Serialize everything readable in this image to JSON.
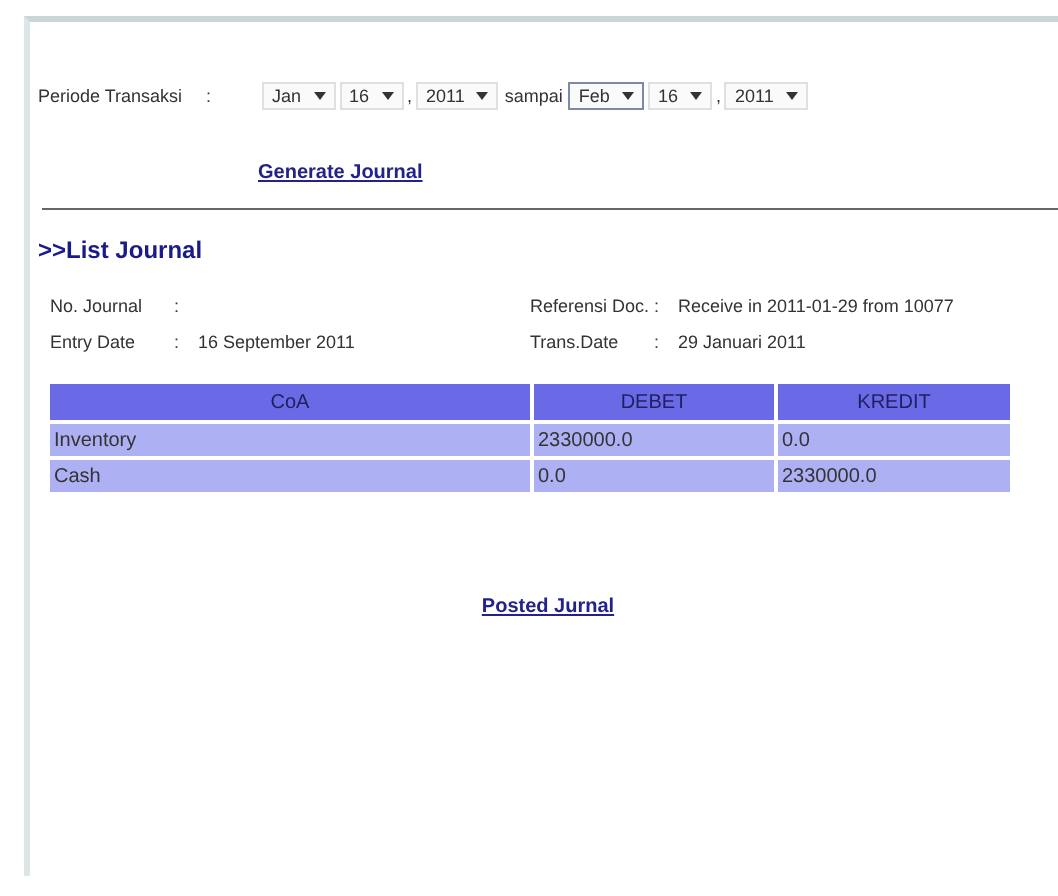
{
  "filter": {
    "label": "Periode Transaksi",
    "colon": ":",
    "separator": "sampai",
    "comma": ",",
    "from": [
      {
        "value": "Jan",
        "focused": false
      },
      {
        "value": "16",
        "focused": false
      },
      {
        "value": "2011",
        "focused": false
      }
    ],
    "to": [
      {
        "value": "Feb",
        "focused": true
      },
      {
        "value": "16",
        "focused": false
      },
      {
        "value": "2011",
        "focused": false
      }
    ],
    "generate_link": "Generate Journal"
  },
  "section_title": ">>List Journal",
  "details": [
    {
      "label": "No. Journal",
      "colon": ":"
    },
    {
      "label": "Referensi Doc.",
      "colon": ":",
      "value": "Receive in 2011-01-29 from 10077"
    },
    {
      "label": "Entry Date",
      "colon": ":",
      "value": "16 September 2011"
    },
    {
      "label": "Trans.Date",
      "colon": ":",
      "value": "29 Januari 2011"
    }
  ],
  "table": {
    "columns": [
      "CoA",
      "DEBET",
      "KREDIT"
    ],
    "rows": [
      [
        "Inventory",
        "2330000.0",
        "0.0"
      ],
      [
        "Cash",
        "0.0",
        "2330000.0"
      ]
    ]
  },
  "posted_link": "Posted Jurnal"
}
